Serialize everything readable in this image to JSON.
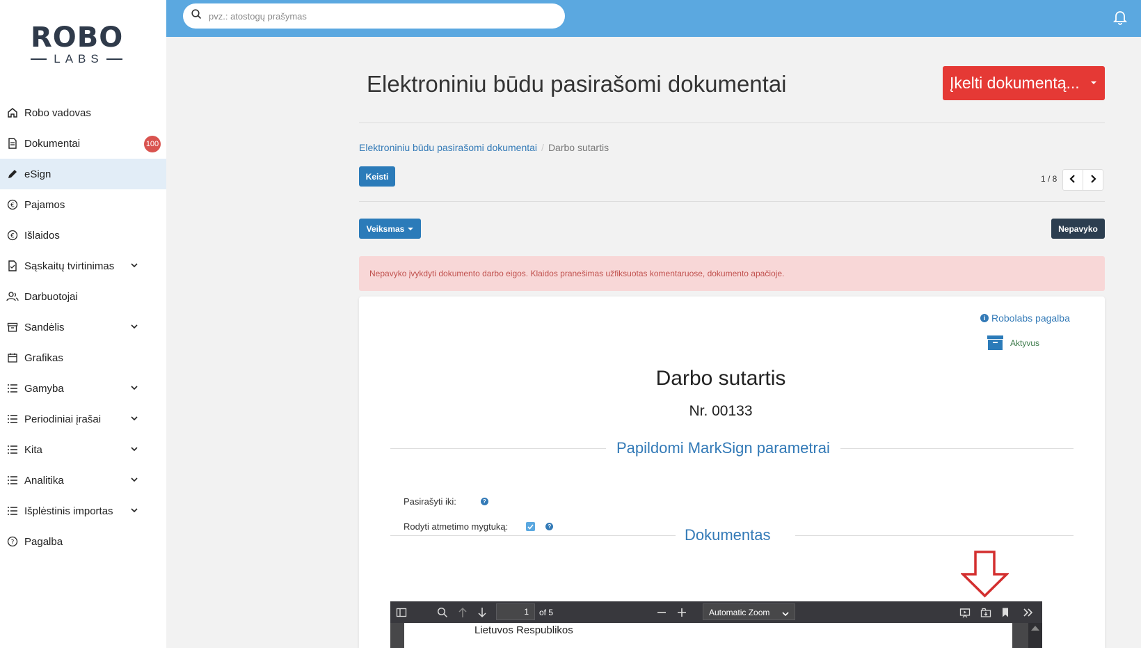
{
  "logo": {
    "top": "ROBO",
    "bottom": "LABS"
  },
  "search": {
    "placeholder": "pvz.: atostogų prašymas"
  },
  "sidebar": {
    "items": [
      {
        "label": "Robo vadovas"
      },
      {
        "label": "Dokumentai",
        "badge": "100"
      },
      {
        "label": "eSign"
      },
      {
        "label": "Pajamos"
      },
      {
        "label": "Išlaidos"
      },
      {
        "label": "Sąskaitų tvirtinimas"
      },
      {
        "label": "Darbuotojai"
      },
      {
        "label": "Sandėlis"
      },
      {
        "label": "Grafikas"
      },
      {
        "label": "Gamyba"
      },
      {
        "label": "Periodiniai įrašai"
      },
      {
        "label": "Kita"
      },
      {
        "label": "Analitika"
      },
      {
        "label": "Išplėstinis importas"
      },
      {
        "label": "Pagalba"
      }
    ]
  },
  "main": {
    "title": "Elektroniniu būdu pasirašomi dokumentai",
    "upload_label": "Įkelti dokumentą...",
    "breadcrumb": {
      "parent": "Elektroniniu būdu pasirašomi dokumentai",
      "sep": "/",
      "current": "Darbo sutartis"
    },
    "edit_label": "Keisti",
    "pager": {
      "count": "1 / 8"
    },
    "action_label": "Veiksmas",
    "status_label": "Nepavyko",
    "alert": "Nepavyko įvykdyti dokumento darbo eigos. Klaidos pranešimas užfiksuotas komentaruose, dokumento apačioje."
  },
  "card": {
    "help_label": "Robolabs pagalba",
    "archive_label": "Aktyvus",
    "doc_title": "Darbo sutartis",
    "doc_nr": "Nr. 00133",
    "section1": "Papildomi MarkSign parametrai",
    "field_sign_until": "Pasirašyti iki:",
    "field_show_reject": "Rodyti atmetimo mygtuką:",
    "question_mark": "?",
    "section2": "Dokumentas"
  },
  "pdf": {
    "page": "1",
    "of": "of 5",
    "zoom": "Automatic Zoom",
    "page_text": "Lietuvos Respublikos"
  },
  "colors": {
    "topbar": "#5ba8e0",
    "primary": "#2b7bb9",
    "danger": "#e53935",
    "dark": "#2c3e50",
    "alert_bg": "#f8d7d7",
    "alert_text": "#c0504d",
    "annotation_arrow": "#d32f2f"
  }
}
